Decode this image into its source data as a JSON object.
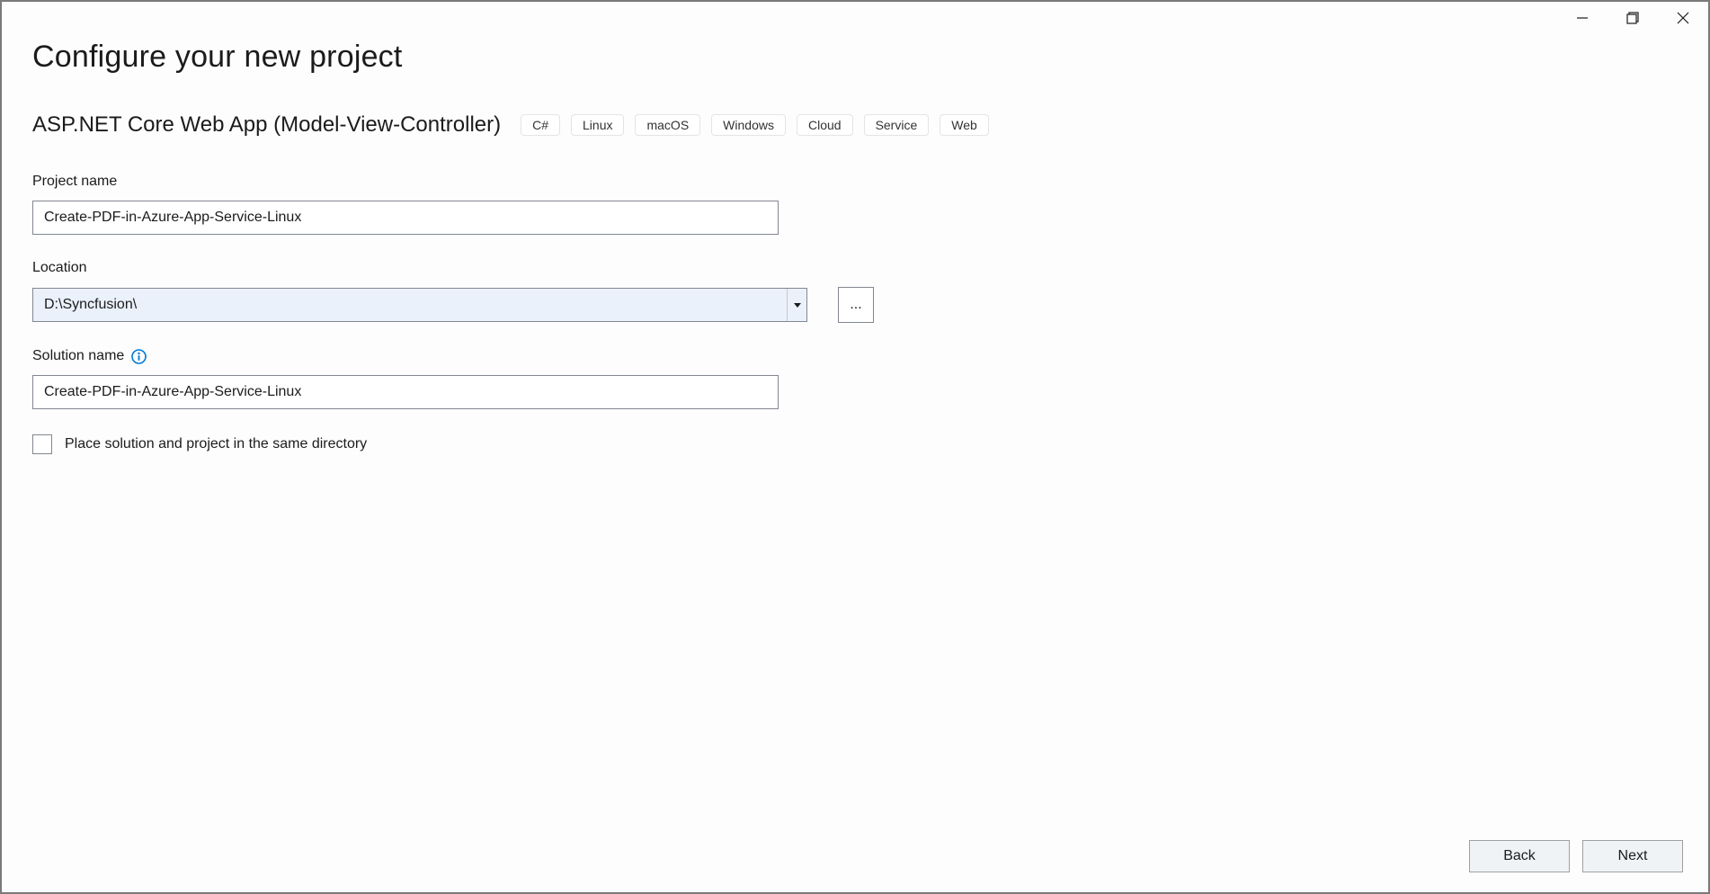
{
  "window": {
    "title": "Configure your new project"
  },
  "template": {
    "name": "ASP.NET Core Web App (Model-View-Controller)",
    "tags": [
      "C#",
      "Linux",
      "macOS",
      "Windows",
      "Cloud",
      "Service",
      "Web"
    ]
  },
  "form": {
    "projectName": {
      "label": "Project name",
      "value": "Create-PDF-in-Azure-App-Service-Linux"
    },
    "location": {
      "label": "Location",
      "value": "D:\\Syncfusion\\",
      "browseLabel": "..."
    },
    "solutionName": {
      "label": "Solution name",
      "value": "Create-PDF-in-Azure-App-Service-Linux"
    },
    "sameDirectory": {
      "label": "Place solution and project in the same directory",
      "checked": false
    }
  },
  "footer": {
    "back": "Back",
    "next": "Next"
  }
}
